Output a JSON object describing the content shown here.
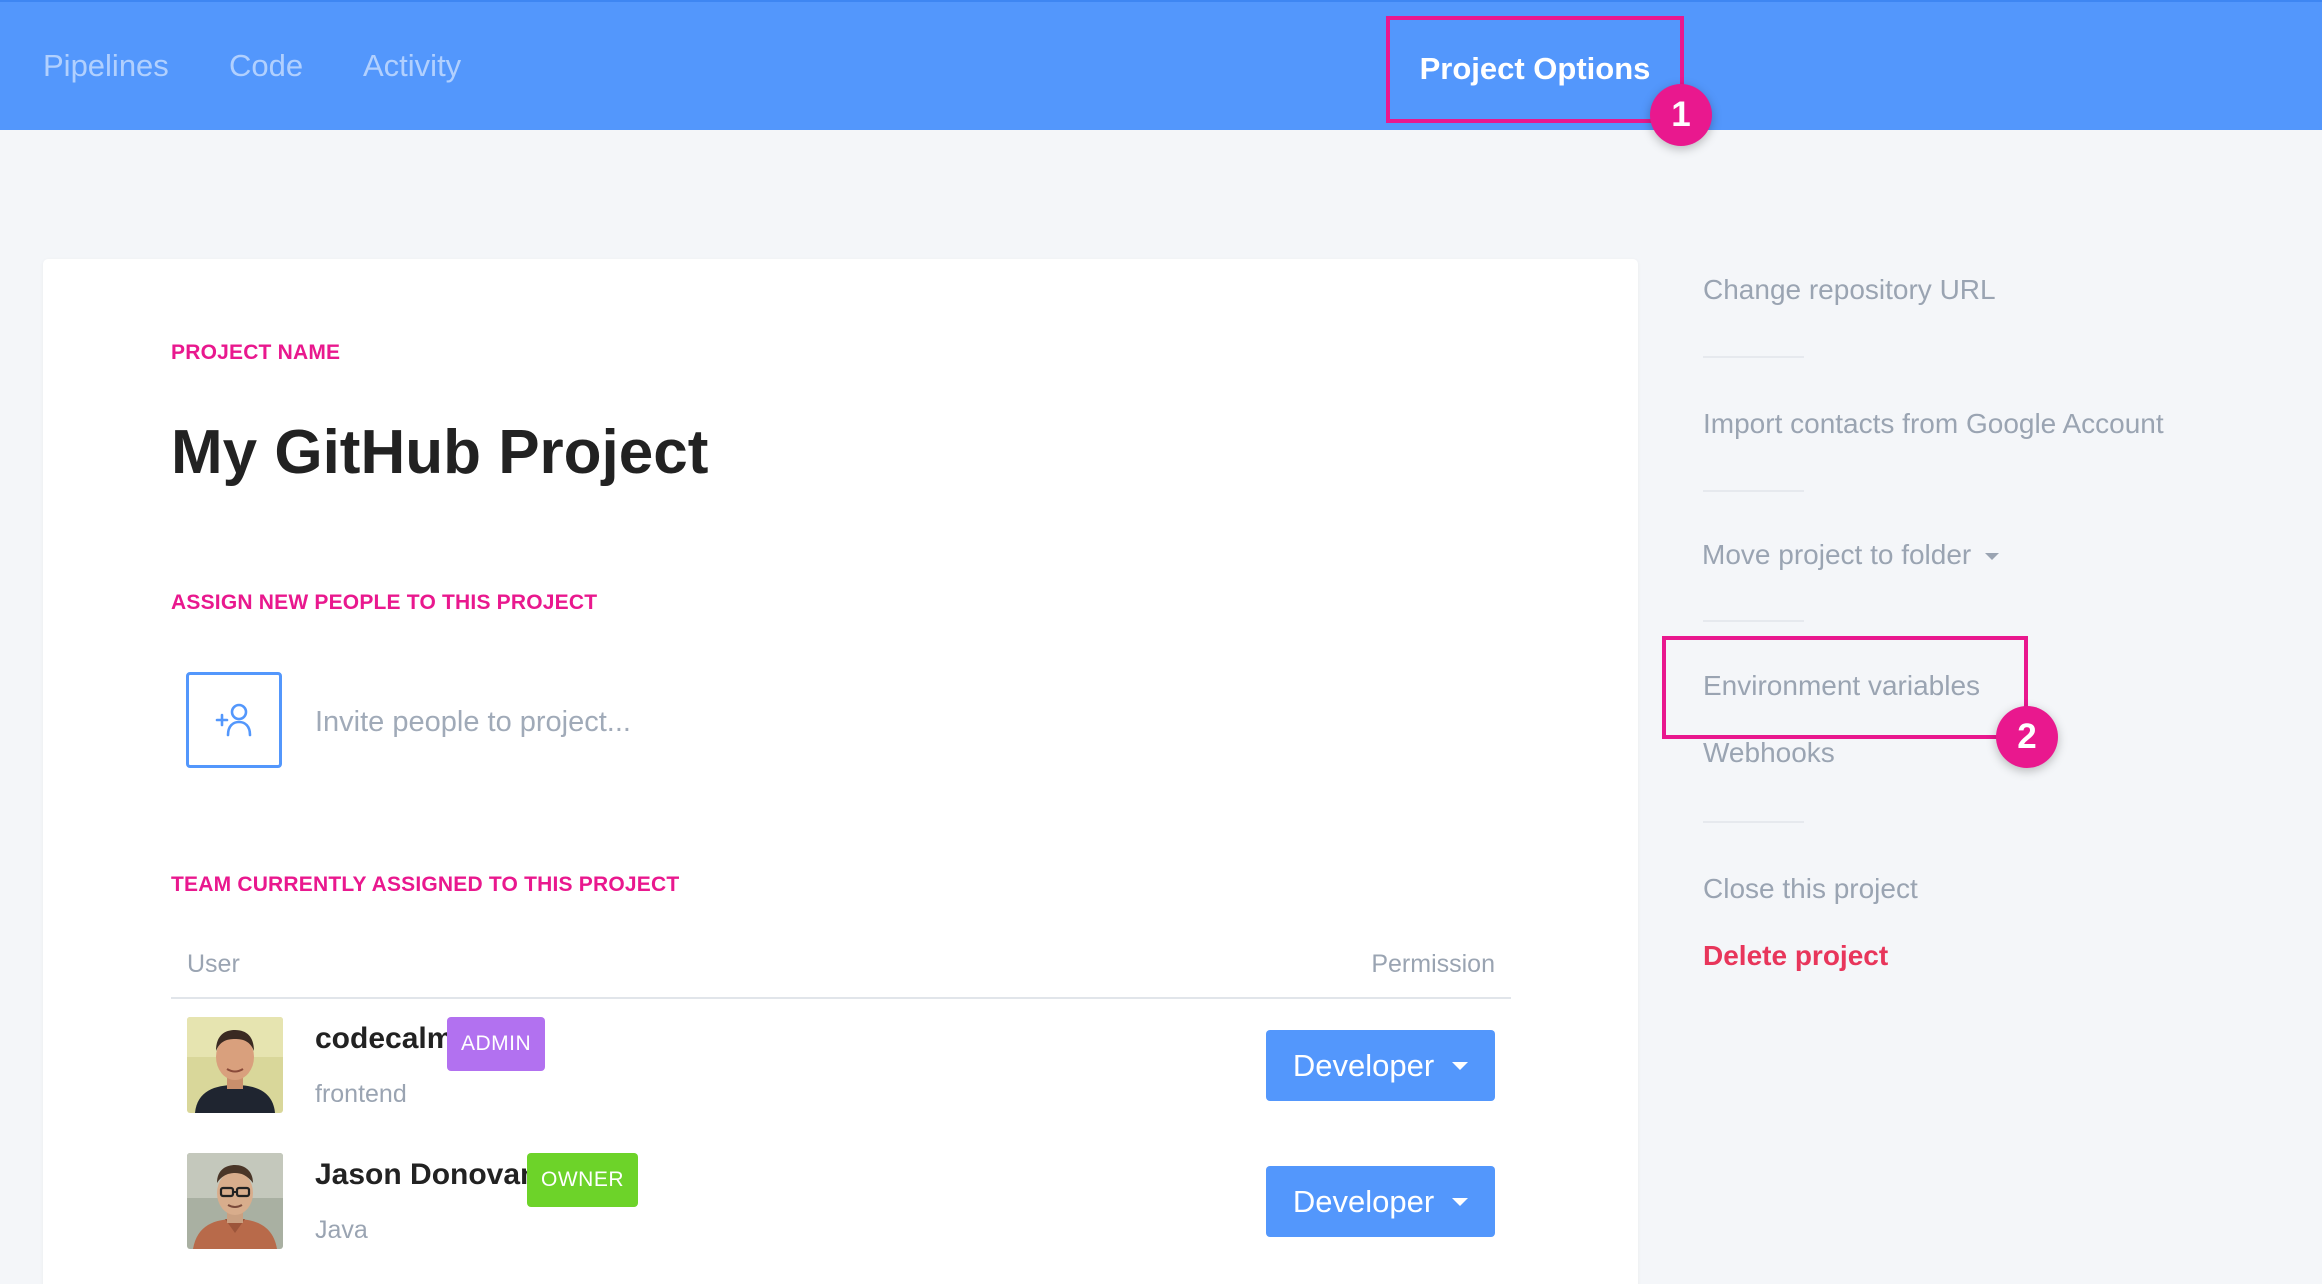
{
  "nav": {
    "items": [
      {
        "label": "Pipelines"
      },
      {
        "label": "Code"
      },
      {
        "label": "Activity"
      }
    ],
    "active_label": "Project Options"
  },
  "callouts": [
    "1",
    "2"
  ],
  "project": {
    "name_label": "PROJECT NAME",
    "name": "My GitHub Project",
    "assign_label": "ASSIGN NEW PEOPLE TO THIS PROJECT",
    "invite_placeholder": "Invite people to project...",
    "team_label": "TEAM CURRENTLY ASSIGNED TO THIS PROJECT"
  },
  "team_table": {
    "columns": {
      "user": "User",
      "permission": "Permission"
    },
    "rows": [
      {
        "name": "codecalm",
        "badge": "ADMIN",
        "sub": "frontend",
        "permission": "Developer"
      },
      {
        "name": "Jason Donovan",
        "badge": "OWNER",
        "sub": "Java",
        "permission": "Developer"
      }
    ]
  },
  "side_menu": {
    "change_repo": "Change repository URL",
    "import_contacts": "Import contacts from Google Account",
    "move_folder": "Move project to folder",
    "env_vars": "Environment variables",
    "webhooks": "Webhooks",
    "close_project": "Close this project",
    "delete_project": "Delete project"
  },
  "colors": {
    "topbar": "#5397fc",
    "accent_pink": "#e9188e",
    "admin_badge": "#b271f0",
    "owner_badge": "#6dd329",
    "danger": "#e8365b"
  },
  "icons": {
    "invite": "add-user-icon",
    "role_dropdown": "caret-down-icon",
    "folder_dropdown": "caret-down-icon"
  }
}
